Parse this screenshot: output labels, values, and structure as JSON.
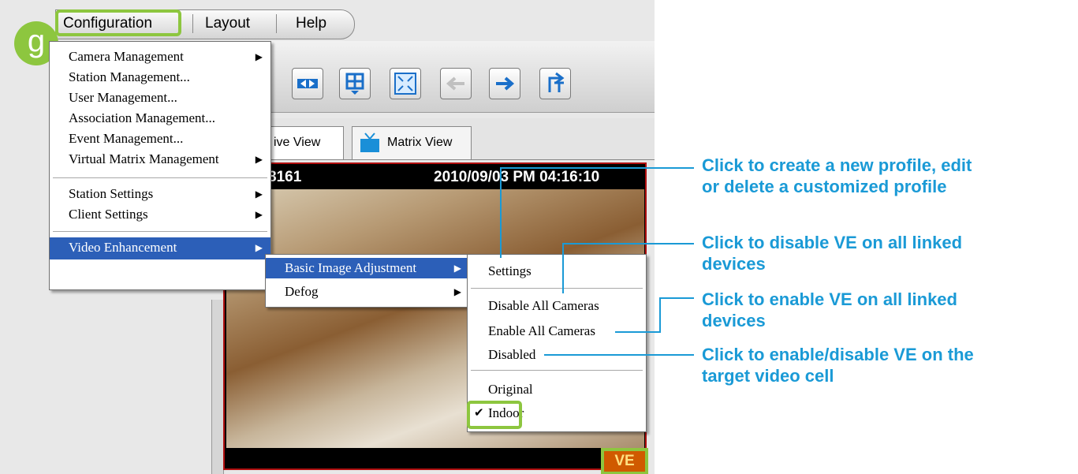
{
  "menubar": {
    "items": [
      "Configuration",
      "Layout",
      "Help"
    ]
  },
  "badge": "g",
  "tabs": [
    "Live View",
    "Matrix View"
  ],
  "tab_live_partial": "ive View",
  "video": {
    "camera_id_partial": "8161",
    "timestamp": "2010/09/03 PM 04:16:10",
    "ve_label": "VE"
  },
  "config_menu": {
    "items": [
      {
        "label": "Camera Management",
        "submenu": true
      },
      {
        "label": "Station Management...",
        "submenu": false
      },
      {
        "label": "User Management...",
        "submenu": false
      },
      {
        "label": "Association Management...",
        "submenu": false
      },
      {
        "label": "Event Management...",
        "submenu": false
      },
      {
        "label": "Virtual Matrix Management",
        "submenu": true
      },
      {
        "label": "Station Settings",
        "submenu": true
      },
      {
        "label": "Client Settings",
        "submenu": true
      },
      {
        "label": "Video Enhancement",
        "submenu": true
      }
    ],
    "selected": "Video Enhancement"
  },
  "ve_menu": {
    "items": [
      "Basic Image Adjustment",
      "Defog"
    ],
    "selected": "Basic Image Adjustment"
  },
  "bia_menu": {
    "items": [
      "Settings",
      "Disable All Cameras",
      "Enable All Cameras",
      "Disabled",
      "Original",
      "Indoor"
    ],
    "checked": "Indoor"
  },
  "annotations": {
    "profile": [
      "Click to create a new profile, edit",
      "or delete a customized profile"
    ],
    "disable_all": [
      "Click to disable VE on all linked",
      "devices"
    ],
    "enable_all": [
      "Click to enable VE on all linked",
      "devices"
    ],
    "toggle": [
      "Click to enable/disable VE on the",
      "target video cell"
    ]
  },
  "colors": {
    "accent_green": "#8dc63f",
    "annotation_blue": "#1a9ad6",
    "menu_selection": "#2c5fb8",
    "ve_badge": "#d05a00"
  },
  "toolbar_icons": [
    "swap-icon",
    "layout-grid-icon",
    "fullscreen-icon",
    "back-arrow-icon",
    "forward-arrow-icon",
    "return-icon"
  ]
}
